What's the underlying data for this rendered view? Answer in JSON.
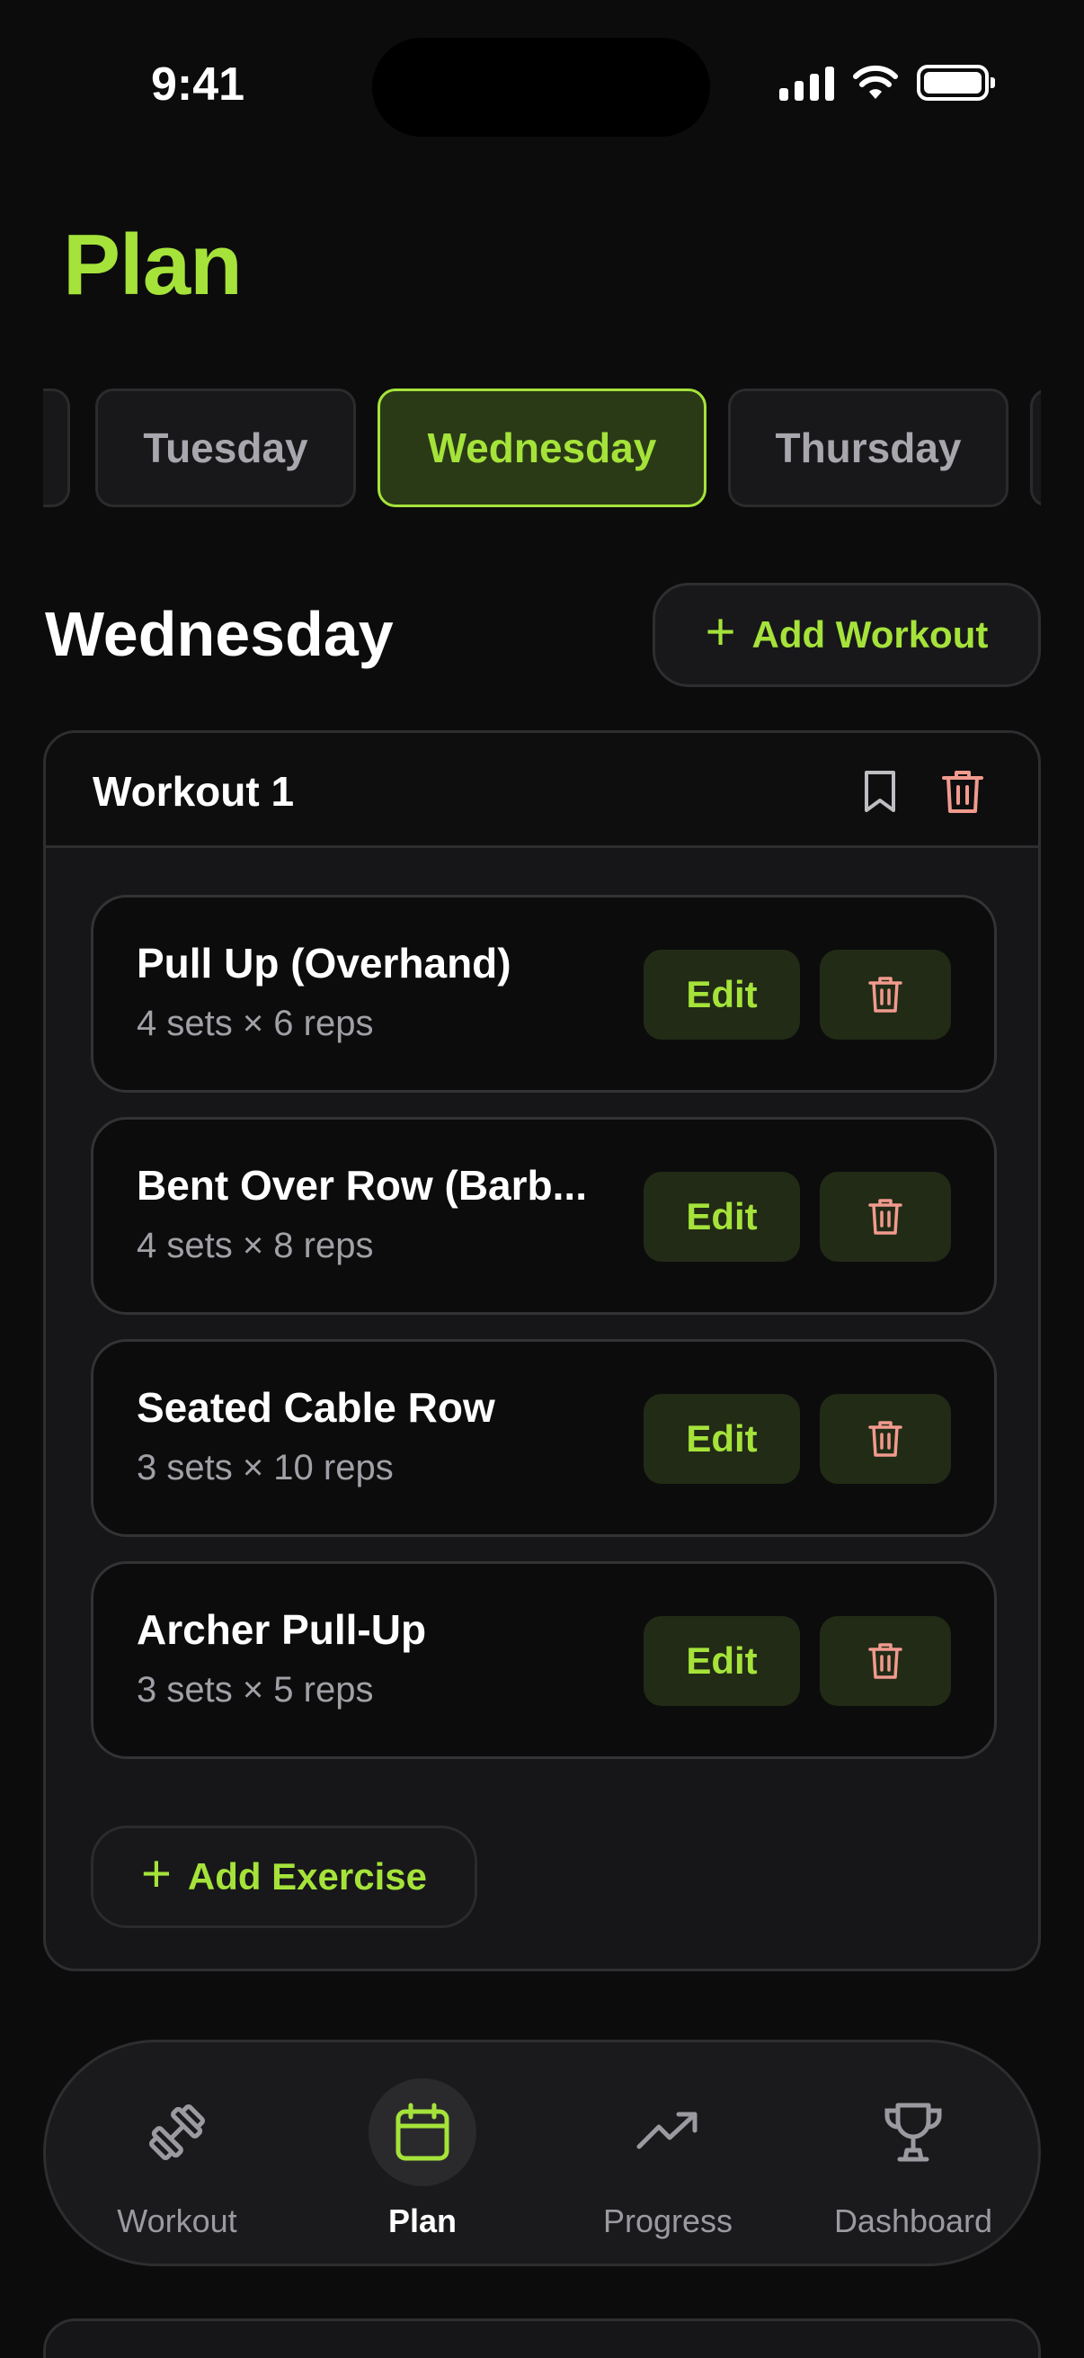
{
  "status_bar": {
    "time": "9:41"
  },
  "header": {
    "title": "Plan"
  },
  "days": {
    "items": [
      "",
      "Tuesday",
      "Wednesday",
      "Thursday",
      ""
    ],
    "selected": "Wednesday"
  },
  "day": {
    "heading": "Wednesday",
    "add_workout_label": "Add Workout"
  },
  "workout": {
    "title": "Workout 1",
    "exercises": [
      {
        "name": "Pull Up (Overhand)",
        "detail": "4 sets × 6 reps",
        "edit_label": "Edit"
      },
      {
        "name": "Bent Over Row (Barb...",
        "detail": "4 sets × 8 reps",
        "edit_label": "Edit"
      },
      {
        "name": "Seated Cable Row",
        "detail": "3 sets × 10 reps",
        "edit_label": "Edit"
      },
      {
        "name": "Archer Pull-Up",
        "detail": "3 sets × 5 reps",
        "edit_label": "Edit"
      }
    ],
    "add_exercise_label": "Add Exercise"
  },
  "nav": {
    "items": [
      {
        "label": "Workout",
        "icon": "dumbbell-icon"
      },
      {
        "label": "Plan",
        "icon": "calendar-icon"
      },
      {
        "label": "Progress",
        "icon": "trending-up-icon"
      },
      {
        "label": "Dashboard",
        "icon": "trophy-icon"
      }
    ],
    "active": "Plan"
  },
  "colors": {
    "accent": "#a5e33a",
    "danger": "#f19a8e",
    "background": "#0c0c0d"
  }
}
